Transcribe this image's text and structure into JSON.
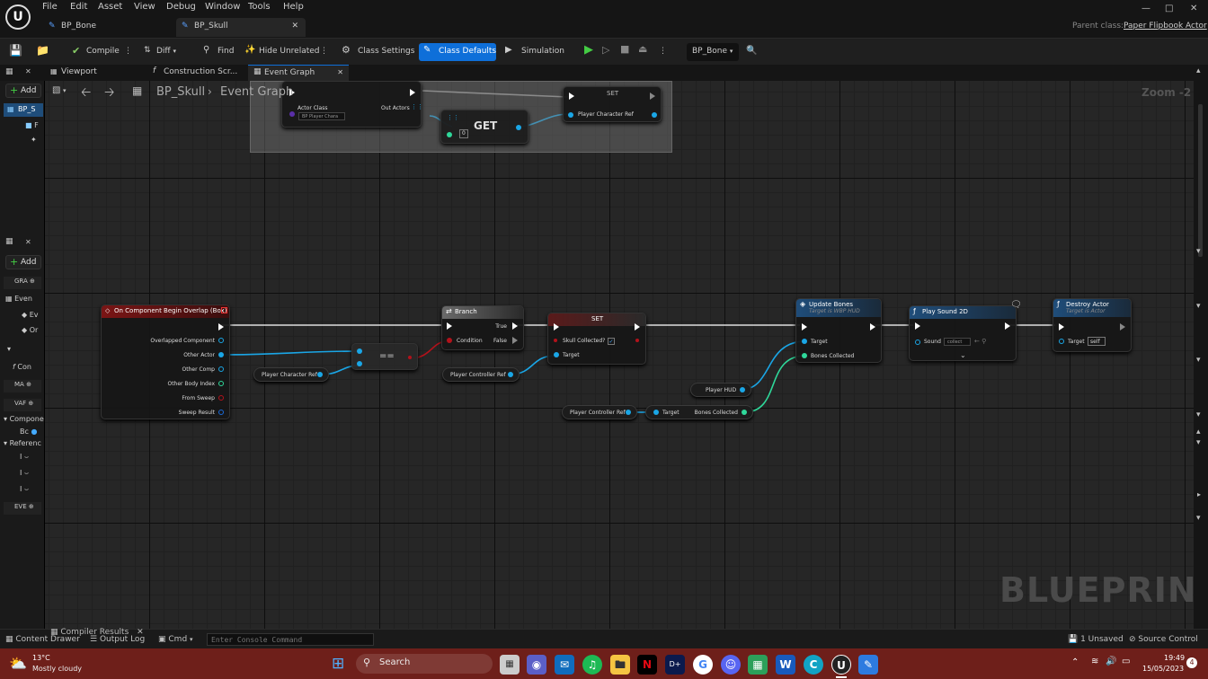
{
  "menu": [
    "File",
    "Edit",
    "Asset",
    "View",
    "Debug",
    "Window",
    "Tools",
    "Help"
  ],
  "doc_tabs": [
    "BP_Bone",
    "BP_Skull"
  ],
  "parent_class_label": "Parent class:",
  "parent_class_value": "Paper Flipbook Actor",
  "toolbar": {
    "compile": "Compile",
    "diff": "Diff",
    "find": "Find",
    "hide_unrelated": "Hide Unrelated",
    "class_settings": "Class Settings",
    "class_defaults": "Class Defaults",
    "simulation": "Simulation",
    "debug_object": "BP_Bone"
  },
  "graph_tabs": [
    "Viewport",
    "Construction Scr...",
    "Event Graph"
  ],
  "left": {
    "add": "Add",
    "tree_root": "BP_S",
    "tree_child": "F",
    "add2": "Add",
    "graphs": "GRA",
    "event_graph": "Even",
    "ev1": "Ev",
    "ev2": "Or",
    "con": "Con",
    "macros": "MA",
    "vars": "VAF",
    "components": "Compone",
    "bc": "Bc",
    "references": "Referenc",
    "ref_items": [
      "I",
      "I",
      "I"
    ],
    "event_dispatchers": "EVE"
  },
  "breadcrumb": {
    "bp": "BP_Skull",
    "graph": "Event Graph"
  },
  "zoom": "Zoom -2",
  "watermark": "BLUEPRINT",
  "nodes": {
    "get_all_actors": {
      "actor_class": "Actor Class",
      "actor_class_value": "BP Player Chara",
      "out_actors": "Out Actors"
    },
    "get": {
      "label": "GET",
      "index": "0"
    },
    "set_top": {
      "title": "SET",
      "pin": "Player Character Ref"
    },
    "event": {
      "title": "On Component Begin Overlap (Box)",
      "pins": [
        "Overlapped Component",
        "Other Actor",
        "Other Comp",
        "Other Body Index",
        "From Sweep",
        "Sweep Result"
      ]
    },
    "equals": {
      "label": "=="
    },
    "player_char_ref": "Player Character Ref",
    "branch": {
      "title": "Branch",
      "true": "True",
      "condition": "Condition",
      "false": "False"
    },
    "set_skull": {
      "title": "SET",
      "var": "Skull Collected?",
      "target": "Target"
    },
    "player_controller_ref_a": "Player Controller Ref",
    "player_hud": "Player HUD",
    "player_controller_ref_b": "Player Controller Ref",
    "bones_get": {
      "target": "Target",
      "out": "Bones Collected"
    },
    "update_bones": {
      "title": "Update Bones",
      "subtitle": "Target is WBP HUD",
      "target": "Target",
      "bones": "Bones Collected"
    },
    "play_sound": {
      "title": "Play Sound 2D",
      "sound": "Sound",
      "sound_value": "collect"
    },
    "destroy": {
      "title": "Destroy Actor",
      "subtitle": "Target is Actor",
      "target": "Target",
      "target_value": "self"
    }
  },
  "statusbar": {
    "content_drawer": "Content Drawer",
    "output_log": "Output Log",
    "cmd": "Cmd",
    "console_placeholder": "Enter Console Command",
    "compiler_results": "Compiler Results",
    "unsaved": "1 Unsaved",
    "source_control": "Source Control"
  },
  "taskbar": {
    "temp": "13°C",
    "weather": "Mostly cloudy",
    "search": "Search",
    "time": "19:49",
    "date": "15/05/2023",
    "notif": "4"
  },
  "colors": {
    "accent": "#0e6fd9",
    "event_header": "#7a1515",
    "function_header": "#1f4d7a",
    "flow_header": "#5a5a5a",
    "set_header": "#3a3a3a",
    "taskbar": "#6e1f1a"
  }
}
